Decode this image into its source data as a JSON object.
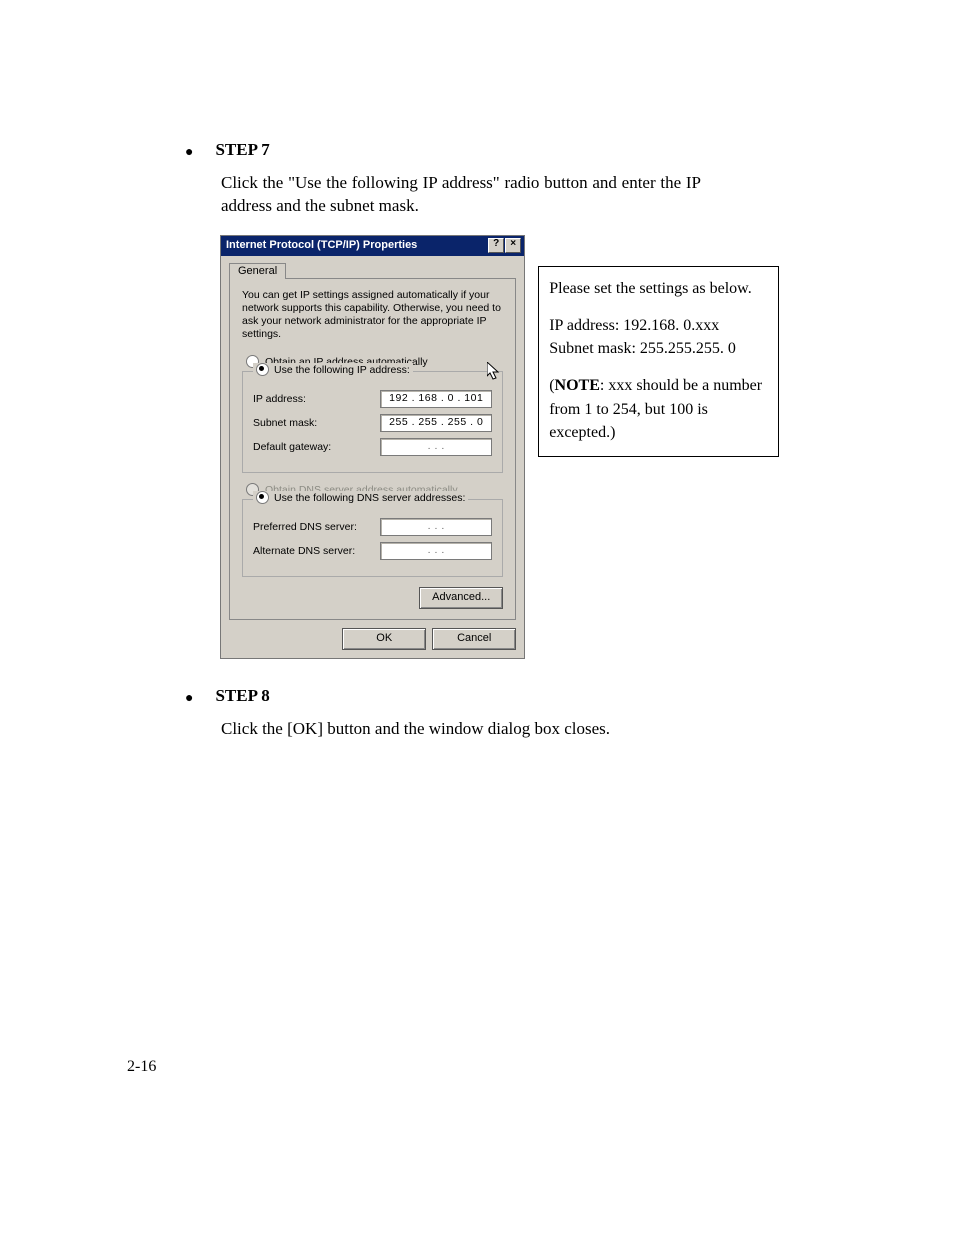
{
  "step7": {
    "title": "STEP 7",
    "body": "Click the \"Use the following IP address\" radio button and enter the IP address and the subnet mask."
  },
  "step8": {
    "title": "STEP 8",
    "body": "Click the [OK] button and the window dialog box closes."
  },
  "dialog": {
    "title": "Internet Protocol (TCP/IP) Properties",
    "help_btn": "?",
    "close_btn": "×",
    "tab": "General",
    "desc": "You can get IP settings assigned automatically if your network supports this capability. Otherwise, you need to ask your network administrator for the appropriate IP settings.",
    "radio_auto_ip": "Obtain an IP address automatically",
    "radio_use_ip": "Use the following IP address:",
    "ip_label": "IP address:",
    "ip_value": "192 . 168 .   0   . 101",
    "subnet_label": "Subnet mask:",
    "subnet_value": "255 . 255 . 255 .   0",
    "gateway_label": "Default gateway:",
    "gateway_value": ".       .       .",
    "radio_auto_dns": "Obtain DNS server address automatically",
    "radio_use_dns": "Use the following DNS server addresses:",
    "pref_dns_label": "Preferred DNS server:",
    "pref_dns_value": ".       .       .",
    "alt_dns_label": "Alternate DNS server:",
    "alt_dns_value": ".       .       .",
    "advanced_btn": "Advanced...",
    "ok_btn": "OK",
    "cancel_btn": "Cancel"
  },
  "note": {
    "line1": "Please set the settings as below.",
    "line2a": "IP address: 192.168. 0.xxx",
    "line2b": "Subnet mask: 255.255.255.   0",
    "line3_bold": "NOTE",
    "line3_rest": ": xxx should be a number from 1 to 254, but 100 is excepted.)"
  },
  "page_number": "2-16"
}
